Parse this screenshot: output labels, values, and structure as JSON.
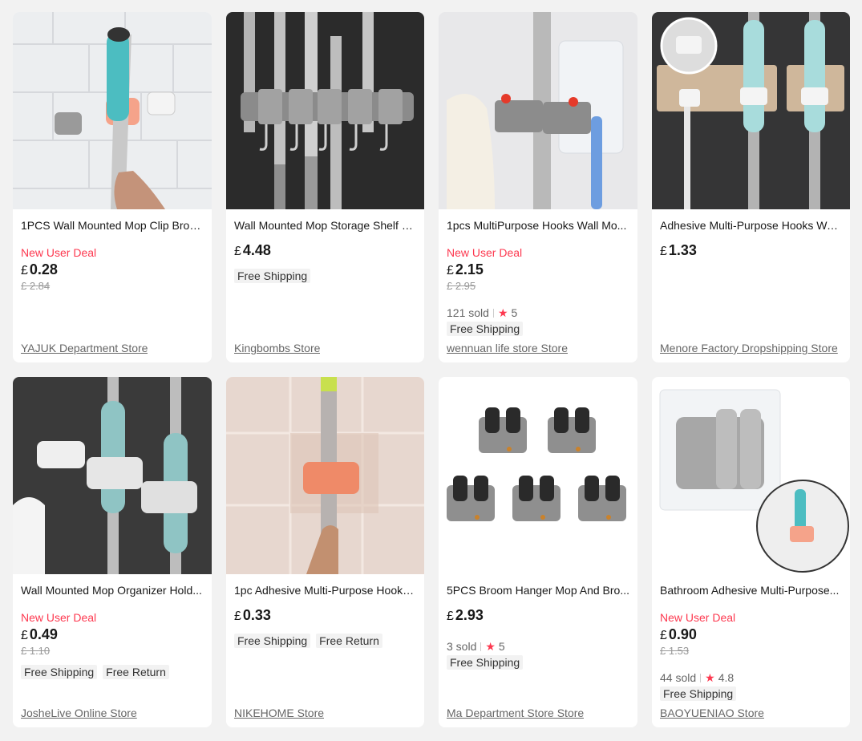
{
  "currency_symbol": "£",
  "colors": {
    "deal_red": "#fd384f",
    "background": "#f2f2f2"
  },
  "products": [
    {
      "title": "1PCS Wall Mounted Mop Clip Broo...",
      "deal": "New User Deal",
      "price": "0.28",
      "original_price": "£ 2.84",
      "store": "YAJUK Department Store",
      "image_icon": "mop-clip-image"
    },
    {
      "title": "Wall Mounted Mop Storage Shelf R...",
      "price": "4.48",
      "tags": [
        "Free Shipping"
      ],
      "store": "Kingbombs Store",
      "image_icon": "mop-shelf-image"
    },
    {
      "title": "1pcs MultiPurpose Hooks Wall Mo...",
      "deal": "New User Deal",
      "price": "2.15",
      "original_price": "£ 2.95",
      "sold": "121 sold",
      "rating": "5",
      "tags": [
        "Free Shipping"
      ],
      "store": "wennuan life store Store",
      "image_icon": "multipurpose-hook-image"
    },
    {
      "title": "Adhesive Multi-Purpose Hooks Wa...",
      "price": "1.33",
      "store": "Menore Factory Dropshipping Store",
      "image_icon": "adhesive-hook-image"
    },
    {
      "title": "Wall Mounted Mop Organizer Hold...",
      "deal": "New User Deal",
      "price": "0.49",
      "original_price": "£ 1.10",
      "tags": [
        "Free Shipping",
        "Free Return"
      ],
      "store": "JosheLive Online Store",
      "image_icon": "mop-organizer-image"
    },
    {
      "title": "1pc Adhesive Multi-Purpose Hooks...",
      "price": "0.33",
      "tags": [
        "Free Shipping",
        "Free Return"
      ],
      "store": "NIKEHOME Store",
      "image_icon": "pink-hook-image"
    },
    {
      "title": "5PCS Broom Hanger Mop And Bro...",
      "price": "2.93",
      "sold": "3 sold",
      "rating": "5",
      "tags": [
        "Free Shipping"
      ],
      "store": "Ma Department Store Store",
      "image_icon": "broom-hanger-set-image"
    },
    {
      "title": "Bathroom Adhesive Multi-Purpose...",
      "deal": "New User Deal",
      "price": "0.90",
      "original_price": "£ 1.53",
      "sold": "44 sold",
      "rating": "4.8",
      "tags": [
        "Free Shipping"
      ],
      "store": "BAOYUENIAO Store",
      "image_icon": "bathroom-hook-image"
    }
  ]
}
